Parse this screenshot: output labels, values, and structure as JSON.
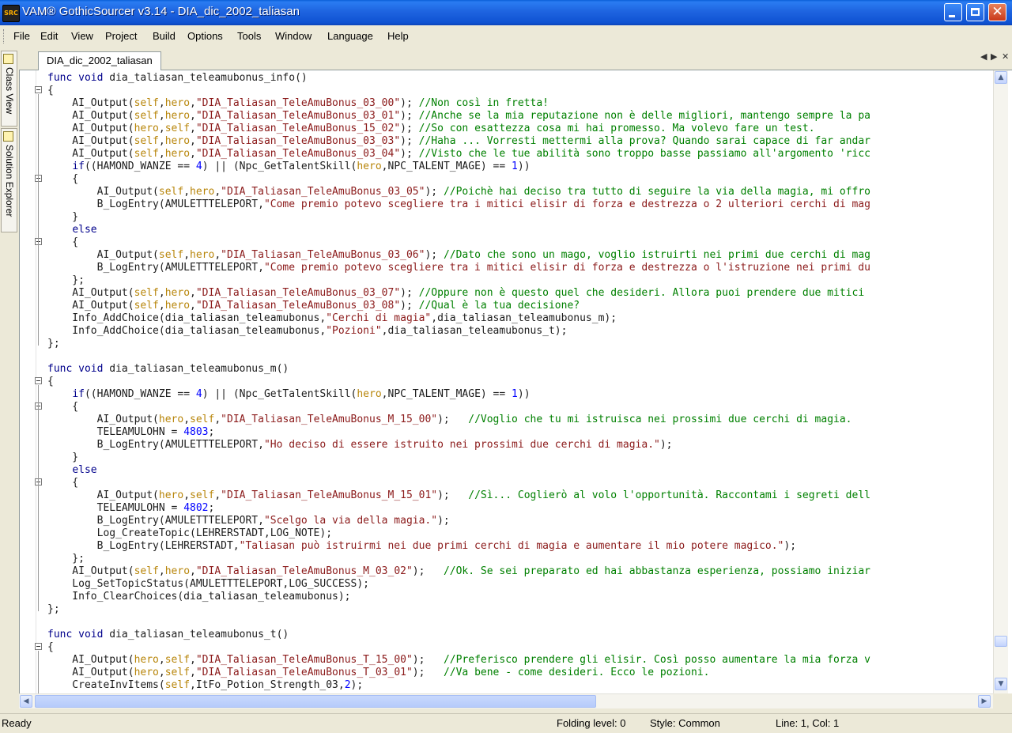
{
  "window": {
    "app_icon_text": "SRC",
    "title": "VAM® GothicSourcer v3.14 - DIA_dic_2002_taliasan",
    "min_glyph": "",
    "max_glyph": "",
    "close_glyph": "✕"
  },
  "menu": [
    "File",
    "Edit",
    "View",
    "Project",
    "Build",
    "Options",
    "Tools",
    "Window",
    "Language",
    "Help"
  ],
  "side_tabs": {
    "class_view": "Class View",
    "solution_explorer": "Solution Explorer"
  },
  "tabs": {
    "active": "DIA_dic_2002_taliasan",
    "prev_glyph": "◀",
    "next_glyph": "▶",
    "close_glyph": "✕"
  },
  "editor": {
    "lines": [
      "@@kw:func@@ @@kw:void@@ dia_taliasan_teleamubonus_info()",
      "{",
      "    AI_Output(@@var:self@@,@@var:hero@@,@@str:\"DIA_Taliasan_TeleAmuBonus_03_00\"@@); @@cmt://Non così in fretta!@@",
      "    AI_Output(@@var:self@@,@@var:hero@@,@@str:\"DIA_Taliasan_TeleAmuBonus_03_01\"@@); @@cmt://Anche se la mia reputazione non è delle migliori, mantengo sempre la pa@@",
      "    AI_Output(@@var:hero@@,@@var:self@@,@@str:\"DIA_Taliasan_TeleAmuBonus_15_02\"@@); @@cmt://So con esattezza cosa mi hai promesso. Ma volevo fare un test.@@",
      "    AI_Output(@@var:self@@,@@var:hero@@,@@str:\"DIA_Taliasan_TeleAmuBonus_03_03\"@@); @@cmt://Haha ... Vorresti mettermi alla prova? Quando sarai capace di far andar@@",
      "    AI_Output(@@var:self@@,@@var:hero@@,@@str:\"DIA_Taliasan_TeleAmuBonus_03_04\"@@); @@cmt://Visto che le tue abilità sono troppo basse passiamo all'argomento 'ricc@@",
      "    @@kw:if@@((HAMOND_WANZE == @@num:4@@) || (Npc_GetTalentSkill(@@var:hero@@,NPC_TALENT_MAGE) == @@num:1@@))",
      "    {",
      "        AI_Output(@@var:self@@,@@var:hero@@,@@str:\"DIA_Taliasan_TeleAmuBonus_03_05\"@@); @@cmt://Poichè hai deciso tra tutto di seguire la via della magia, mi offro@@",
      "        B_LogEntry(AMULETTTELEPORT,@@str:\"Come premio potevo scegliere tra i mitici elisir di forza e destrezza o 2 ulteriori cerchi di mag@@",
      "    }",
      "    @@kw:else@@",
      "    {",
      "        AI_Output(@@var:self@@,@@var:hero@@,@@str:\"DIA_Taliasan_TeleAmuBonus_03_06\"@@); @@cmt://Dato che sono un mago, voglio istruirti nei primi due cerchi di mag@@",
      "        B_LogEntry(AMULETTTELEPORT,@@str:\"Come premio potevo scegliere tra i mitici elisir di forza e destrezza o l'istruzione nei primi du@@",
      "    };",
      "    AI_Output(@@var:self@@,@@var:hero@@,@@str:\"DIA_Taliasan_TeleAmuBonus_03_07\"@@); @@cmt://Oppure non è questo quel che desideri. Allora puoi prendere due mitici@@",
      "    AI_Output(@@var:self@@,@@var:hero@@,@@str:\"DIA_Taliasan_TeleAmuBonus_03_08\"@@); @@cmt://Qual è la tua decisione?@@",
      "    Info_AddChoice(dia_taliasan_teleamubonus,@@str:\"Cerchi di magia\"@@,dia_taliasan_teleamubonus_m);",
      "    Info_AddChoice(dia_taliasan_teleamubonus,@@str:\"Pozioni\"@@,dia_taliasan_teleamubonus_t);",
      "};",
      "",
      "@@kw:func@@ @@kw:void@@ dia_taliasan_teleamubonus_m()",
      "{",
      "    @@kw:if@@((HAMOND_WANZE == @@num:4@@) || (Npc_GetTalentSkill(@@var:hero@@,NPC_TALENT_MAGE) == @@num:1@@))",
      "    {",
      "        AI_Output(@@var:hero@@,@@var:self@@,@@str:\"DIA_Taliasan_TeleAmuBonus_M_15_00\"@@);   @@cmt://Voglio che tu mi istruisca nei prossimi due cerchi di magia.@@",
      "        TELEAMULOHN = @@num:4803@@;",
      "        B_LogEntry(AMULETTTELEPORT,@@str:\"Ho deciso di essere istruito nei prossimi due cerchi di magia.\"@@);",
      "    }",
      "    @@kw:else@@",
      "    {",
      "        AI_Output(@@var:hero@@,@@var:self@@,@@str:\"DIA_Taliasan_TeleAmuBonus_M_15_01\"@@);   @@cmt://Sì... Coglierò al volo l'opportunità. Raccontami i segreti dell@@",
      "        TELEAMULOHN = @@num:4802@@;",
      "        B_LogEntry(AMULETTTELEPORT,@@str:\"Scelgo la via della magia.\"@@);",
      "        Log_CreateTopic(LEHRERSTADT,LOG_NOTE);",
      "        B_LogEntry(LEHRERSTADT,@@str:\"Taliasan può istruirmi nei due primi cerchi di magia e aumentare il mio potere magico.\"@@);",
      "    };",
      "    AI_Output(@@var:self@@,@@var:hero@@,@@str:\"DIA_Taliasan_TeleAmuBonus_M_03_02\"@@);   @@cmt://Ok. Se sei preparato ed hai abbastanza esperienza, possiamo iniziar@@",
      "    Log_SetTopicStatus(AMULETTTELEPORT,LOG_SUCCESS);",
      "    Info_ClearChoices(dia_taliasan_teleamubonus);",
      "};",
      "",
      "@@kw:func@@ @@kw:void@@ dia_taliasan_teleamubonus_t()",
      "{",
      "    AI_Output(@@var:hero@@,@@var:self@@,@@str:\"DIA_Taliasan_TeleAmuBonus_T_15_00\"@@);   @@cmt://Preferisco prendere gli elisir. Così posso aumentare la mia forza v@@",
      "    AI_Output(@@var:hero@@,@@var:self@@,@@str:\"DIA_Taliasan_TeleAmuBonus_T_03_01\"@@);   @@cmt://Va bene - come desideri. Ecco le pozioni.@@",
      "    CreateInvItems(@@var:self@@,ItFo_Potion_Strength_03,@@num:2@@);"
    ]
  },
  "scrollbars": {
    "up": "▲",
    "down": "▼",
    "left": "◀",
    "right": "▶"
  },
  "status": {
    "ready": "Ready",
    "folding": "Folding level: 0",
    "style": "Style: Common",
    "position": "Line: 1, Col: 1"
  }
}
